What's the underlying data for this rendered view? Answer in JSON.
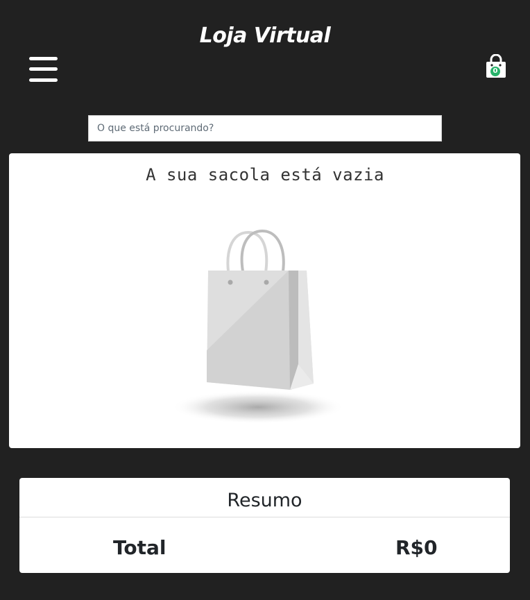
{
  "header": {
    "title": "Loja Virtual",
    "menu_icon": "hamburger-menu-icon",
    "cart_icon": "shopping-bag-icon",
    "cart_count": "0",
    "cart_count_color": "#27b36a"
  },
  "search": {
    "placeholder": "O que está procurando?",
    "value": ""
  },
  "bag": {
    "empty_message": "A sua sacola está vazia",
    "illustration_icon": "empty-shopping-bag-illustration"
  },
  "summary": {
    "title": "Resumo",
    "total_label": "Total",
    "total_value": "R$0"
  },
  "colors": {
    "background": "#212121",
    "card": "#ffffff",
    "accent": "#27b36a"
  }
}
